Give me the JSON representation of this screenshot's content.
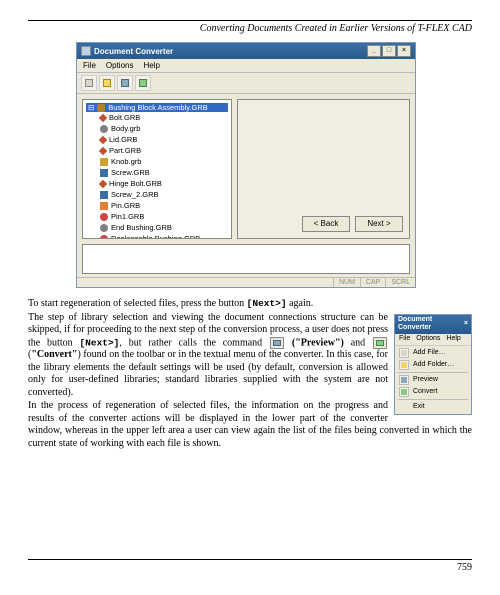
{
  "header": {
    "title": "Converting Documents Created in Earlier Versions of T-FLEX CAD"
  },
  "dialog": {
    "title": "Document Converter",
    "sysbuttons": {
      "min": "_",
      "max": "□",
      "close": "×"
    },
    "menu": {
      "file": "File",
      "options": "Options",
      "help": "Help"
    },
    "tree": {
      "root": "Bushing Block Assembly.GRB",
      "items": [
        "Bolt.GRB",
        "Body.grb",
        "Lid.GRB",
        "Part.GRB",
        "Knob.grb",
        "Screw.GRB",
        "Hinge Bolt.GRB",
        "Screw_2.GRB",
        "Pin.GRB",
        "Pin1.GRB",
        "End Bushing.GRB",
        "Replaceable Bushing.GRB"
      ]
    },
    "nav": {
      "back": "< Back",
      "next": "Next >"
    },
    "status": {
      "num": "NUM",
      "cap": "CAP",
      "scrl": "SCRL"
    }
  },
  "contextmenu": {
    "title": "Document Converter",
    "menubar": {
      "file": "File",
      "options": "Options",
      "help": "Help"
    },
    "items": {
      "addfile": "Add File…",
      "addfolder": "Add Folder…",
      "preview": "Preview",
      "convert": "Convert",
      "exit": "Exit"
    }
  },
  "text": {
    "p1a": "To start regeneration of selected files, press the button ",
    "p1_btn": "[Next>]",
    "p1b": " again.",
    "p2a": "The step of library selection and viewing the document connections structure can be skipped, if for proceeding to the next step of the conversion process, a user does not press the button ",
    "p2_btn": "[Next>]",
    "p2b": ", but rather calls the command ",
    "p2_prev": "(\"Preview\")",
    "p2c": " and ",
    "p3a": " (",
    "p3_conv": "\"Convert\"",
    "p3b": ") found on the toolbar or in the textual menu of the converter. In this case, for the library elements the default settings will be used (by default, conversion is allowed only for user-defined libraries; standard libraries supplied with the system are not converted).",
    "p4": "In the process of regeneration of selected files, the information on the progress and results of the converter actions will be displayed in the lower part of the converter window, whereas in the upper left area a user can view again the list of the files being converted in which the current state of working with each file is shown."
  },
  "footer": {
    "page": "759"
  }
}
